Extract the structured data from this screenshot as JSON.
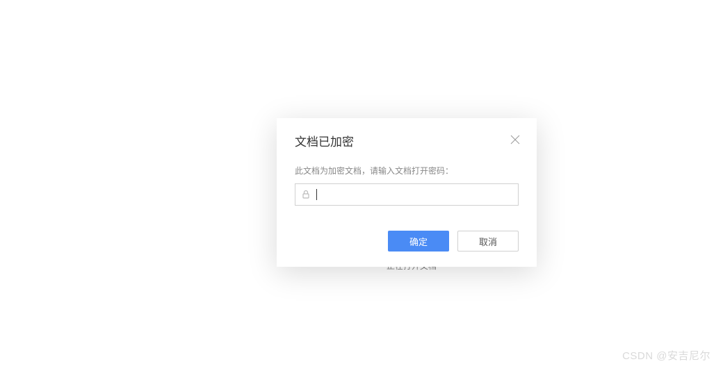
{
  "dialog": {
    "title": "文档已加密",
    "label": "此文档为加密文档，请输入文档打开密码：",
    "input": {
      "value": "",
      "placeholder": ""
    },
    "buttons": {
      "confirm": "确定",
      "cancel": "取消"
    }
  },
  "watermark": "CSDN @安吉尼尔",
  "colors": {
    "primary": "#4a8bf5",
    "border": "#d0d0d0",
    "text_muted": "#888888"
  }
}
